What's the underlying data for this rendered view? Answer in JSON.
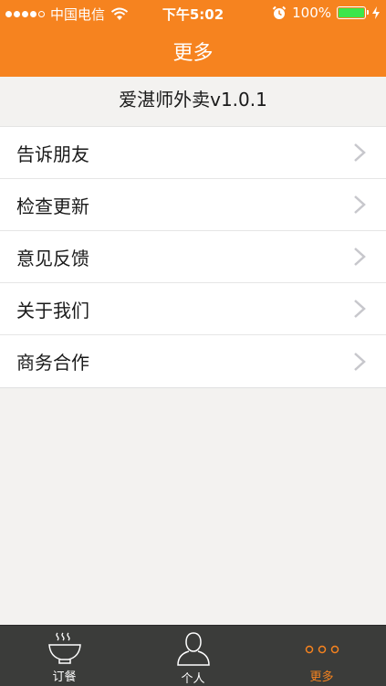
{
  "status_bar": {
    "carrier": "中国电信",
    "time": "下午5:02",
    "battery": "100%",
    "signal_bars": 4
  },
  "nav": {
    "title": "更多"
  },
  "version_text": "爱湛师外卖v1.0.1",
  "menu": [
    {
      "label": "告诉朋友"
    },
    {
      "label": "检查更新"
    },
    {
      "label": "意见反馈"
    },
    {
      "label": "关于我们"
    },
    {
      "label": "商务合作"
    }
  ],
  "tabs": [
    {
      "label": "订餐",
      "icon": "bowl-icon"
    },
    {
      "label": "个人",
      "icon": "person-icon"
    },
    {
      "label": "更多",
      "icon": "more-dots-icon"
    }
  ],
  "active_tab": 2,
  "colors": {
    "accent": "#f6831f",
    "tabbar": "#3b3c3a",
    "battery": "#3ce64b"
  }
}
